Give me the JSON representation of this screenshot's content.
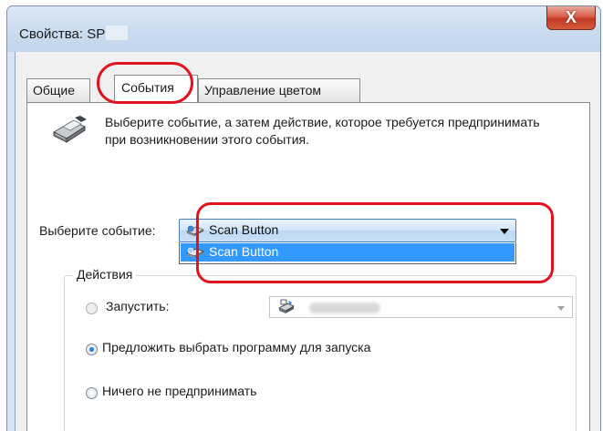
{
  "window": {
    "title": "Свойства: SP",
    "close_label": "X"
  },
  "tabs": [
    {
      "label": "Общие",
      "active": false
    },
    {
      "label": "События",
      "active": true
    },
    {
      "label": "Управление цветом",
      "active": false
    }
  ],
  "events_page": {
    "description": "Выберите событие, а затем действие, которое требуется предпринимать при возникновении этого события.",
    "event_label": "Выберите событие:",
    "event_selected": "Scan Button",
    "event_options": [
      "Scan Button"
    ],
    "actions": {
      "group_label": "Действия",
      "launch_label": "Запустить:",
      "prompt_label": "Предложить выбрать программу для запуска",
      "nothing_label": "Ничего не предпринимать",
      "selected": "prompt"
    }
  },
  "icons": {
    "scanner": "scanner-icon",
    "scan_button": "scan-button-icon",
    "program": "program-icon"
  },
  "colors": {
    "highlight": "#e0141e",
    "selection": "#3399ff",
    "close_button": "#c23a23"
  }
}
